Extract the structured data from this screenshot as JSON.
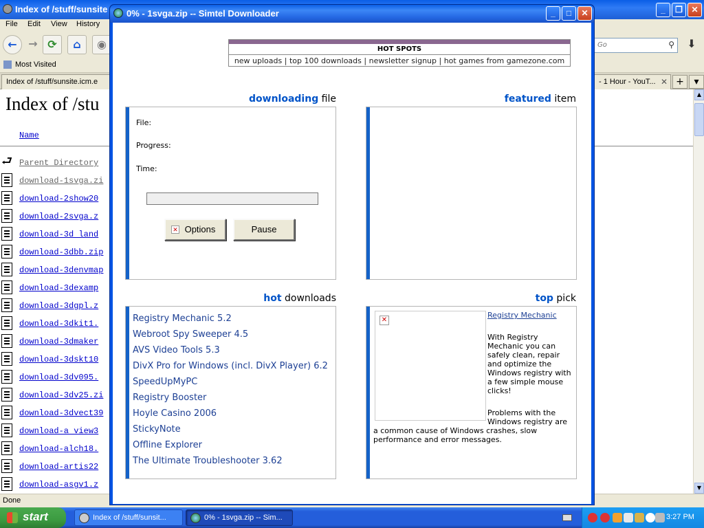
{
  "browser": {
    "title": "Index of /stuff/sunsite",
    "menu": [
      "File",
      "Edit",
      "View",
      "History"
    ],
    "search_text": "Go",
    "bookmarks": {
      "most_visited": "Most Visited"
    },
    "tabs": {
      "active": "Index of /stuff/sunsite.icm.e",
      "other": "- 1 Hour - YouT..."
    },
    "page_heading": "Index of /stu",
    "column_name": "Name",
    "parent_dir": "Parent Directory",
    "files": [
      "download-1svga.zi",
      "download-2show20",
      "download-2svga.z",
      "download-3d land",
      "download-3dbb.zip",
      "download-3denvmap",
      "download-3dexamp",
      "download-3dgpl.z",
      "download-3dkit1.",
      "download-3dmaker",
      "download-3dskt10",
      "download-3dv095.",
      "download-3dv25.zi",
      "download-3dvect39",
      "download-a view3",
      "download-alch18.",
      "download-artis22",
      "download-asgv1.z"
    ],
    "status": "Done"
  },
  "taskbar": {
    "start": "start",
    "tasks": [
      {
        "label": "Index of /stuff/sunsit..."
      },
      {
        "label": "0% - 1svga.zip -- Sim..."
      }
    ],
    "clock": "3:27 PM"
  },
  "downloader": {
    "title": "0% - 1svga.zip -- Simtel Downloader",
    "hotspots": {
      "heading": "HOT SPOTS",
      "links": [
        "new uploads",
        "top 100 downloads",
        "newsletter signup",
        "hot games from gamezone.com"
      ],
      "separator": " | "
    },
    "downloading": {
      "head_bold": "downloading",
      "head_rest": " file",
      "file_label": "File:",
      "progress_label": "Progress:",
      "time_label": "Time:",
      "progress_value": 0,
      "options_label": "Options",
      "pause_label": "Pause"
    },
    "featured": {
      "head_bold": "featured",
      "head_rest": " item"
    },
    "hot_downloads": {
      "head_bold": "hot",
      "head_rest": " downloads",
      "items": [
        "Registry Mechanic 5.2",
        "Webroot Spy Sweeper 4.5",
        "AVS Video Tools 5.3",
        "DivX Pro for Windows (incl. DivX Player) 6.2",
        "SpeedUpMyPC",
        "Registry Booster",
        "Hoyle Casino 2006",
        "StickyNote",
        "Offline Explorer",
        "The Ultimate Troubleshooter 3.62"
      ]
    },
    "top_pick": {
      "head_bold": "top",
      "head_rest": " pick",
      "link": "Registry Mechanic",
      "desc1": "With Registry Mechanic you can safely clean, repair and optimize the Windows registry with a few simple mouse clicks!",
      "desc2": "Problems with the Windows registry are",
      "desc3": "a common cause of Windows crashes, slow performance and error messages."
    }
  }
}
